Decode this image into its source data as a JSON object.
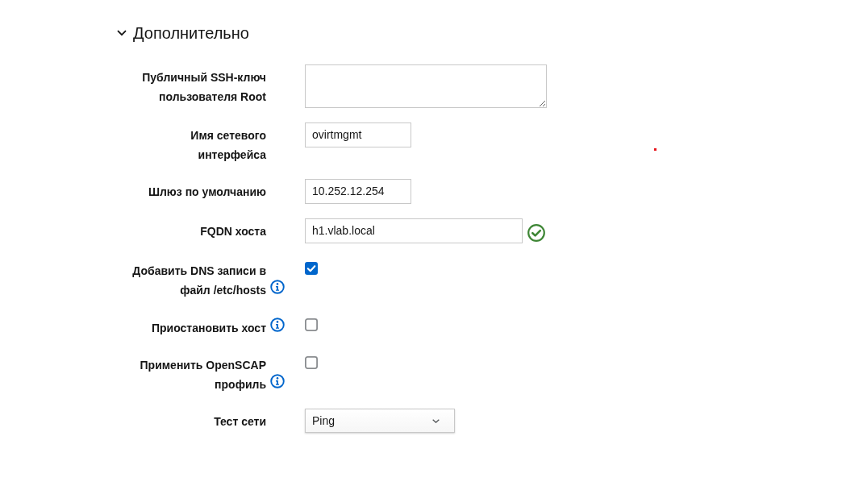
{
  "section": {
    "title": "Дополнительно",
    "expanded": true
  },
  "fields": [
    {
      "kind": "textarea",
      "label": "Публичный SSH-ключ пользователя Root",
      "info": false
    },
    {
      "kind": "text",
      "label": "Имя сетевого интерфейса",
      "value": "ovirtmgmt",
      "info": false,
      "validated": false
    },
    {
      "kind": "text",
      "label": "Шлюз по умолчанию",
      "value": "10.252.12.254",
      "info": false,
      "validated": false
    },
    {
      "kind": "text",
      "label": "FQDN хоста",
      "value": "h1.vlab.local",
      "info": false,
      "validated": true
    },
    {
      "kind": "checkbox",
      "label": "Добавить DNS записи в файл /etc/hosts",
      "checked": true,
      "info": true
    },
    {
      "kind": "checkbox",
      "label": "Приостановить хост",
      "checked": false,
      "info": true
    },
    {
      "kind": "checkbox",
      "label": "Применить OpenSCAP профиль",
      "checked": false,
      "info": true
    },
    {
      "kind": "select",
      "label": "Тест сети",
      "value": "Ping",
      "info": false
    }
  ]
}
